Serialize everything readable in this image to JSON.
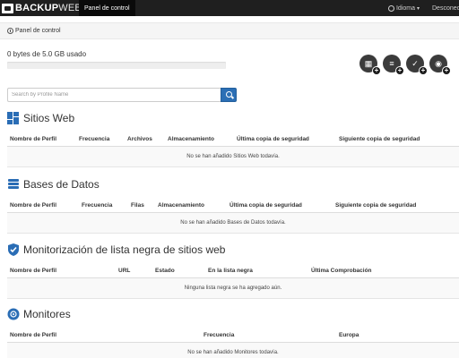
{
  "navbar": {
    "brand_bold": "BACKUP",
    "brand_light": "WEB",
    "active_tab": "Panel de control",
    "language": "Idioma",
    "disconnect": "Desconectar"
  },
  "breadcrumb": {
    "label": "Panel de control"
  },
  "storage": {
    "text": "0 bytes de 5.0 GB usado",
    "used_fraction": 0.0
  },
  "actions": [
    {
      "icon": "add-website-icon"
    },
    {
      "icon": "add-database-icon"
    },
    {
      "icon": "add-blacklist-monitor-icon"
    },
    {
      "icon": "add-monitor-icon"
    }
  ],
  "search": {
    "placeholder": "Search by Profile Name",
    "value": ""
  },
  "sections": {
    "sites": {
      "title": "Sitios Web",
      "headers": [
        "Nombre de Perfil",
        "Frecuencia",
        "Archivos",
        "Almacenamiento",
        "Última copia de seguridad",
        "Siguiente copia de seguridad"
      ],
      "empty": "No se han añadido Sitios Web todavía."
    },
    "databases": {
      "title": "Bases de Datos",
      "headers": [
        "Nombre de Perfil",
        "Frecuencia",
        "Filas",
        "Almacenamiento",
        "Última copia de seguridad",
        "Siguiente copia de seguridad"
      ],
      "empty": "No se han añadido Bases de Datos todavía."
    },
    "blacklist": {
      "title": "Monitorización de lista negra de sitios web",
      "headers": [
        "Nombre de Perfil",
        "URL",
        "Estado",
        "En la lista negra",
        "Última Comprobación"
      ],
      "empty": "Ninguna lista negra se ha agregado aún."
    },
    "monitors": {
      "title": "Monitores",
      "headers": [
        "Nombre de Perfil",
        "Frecuencia",
        "Europa"
      ],
      "empty": "No se han añadido Monitores todavía."
    }
  },
  "colors": {
    "navbar": "#1f1f1f",
    "accent": "#2a6db5"
  }
}
